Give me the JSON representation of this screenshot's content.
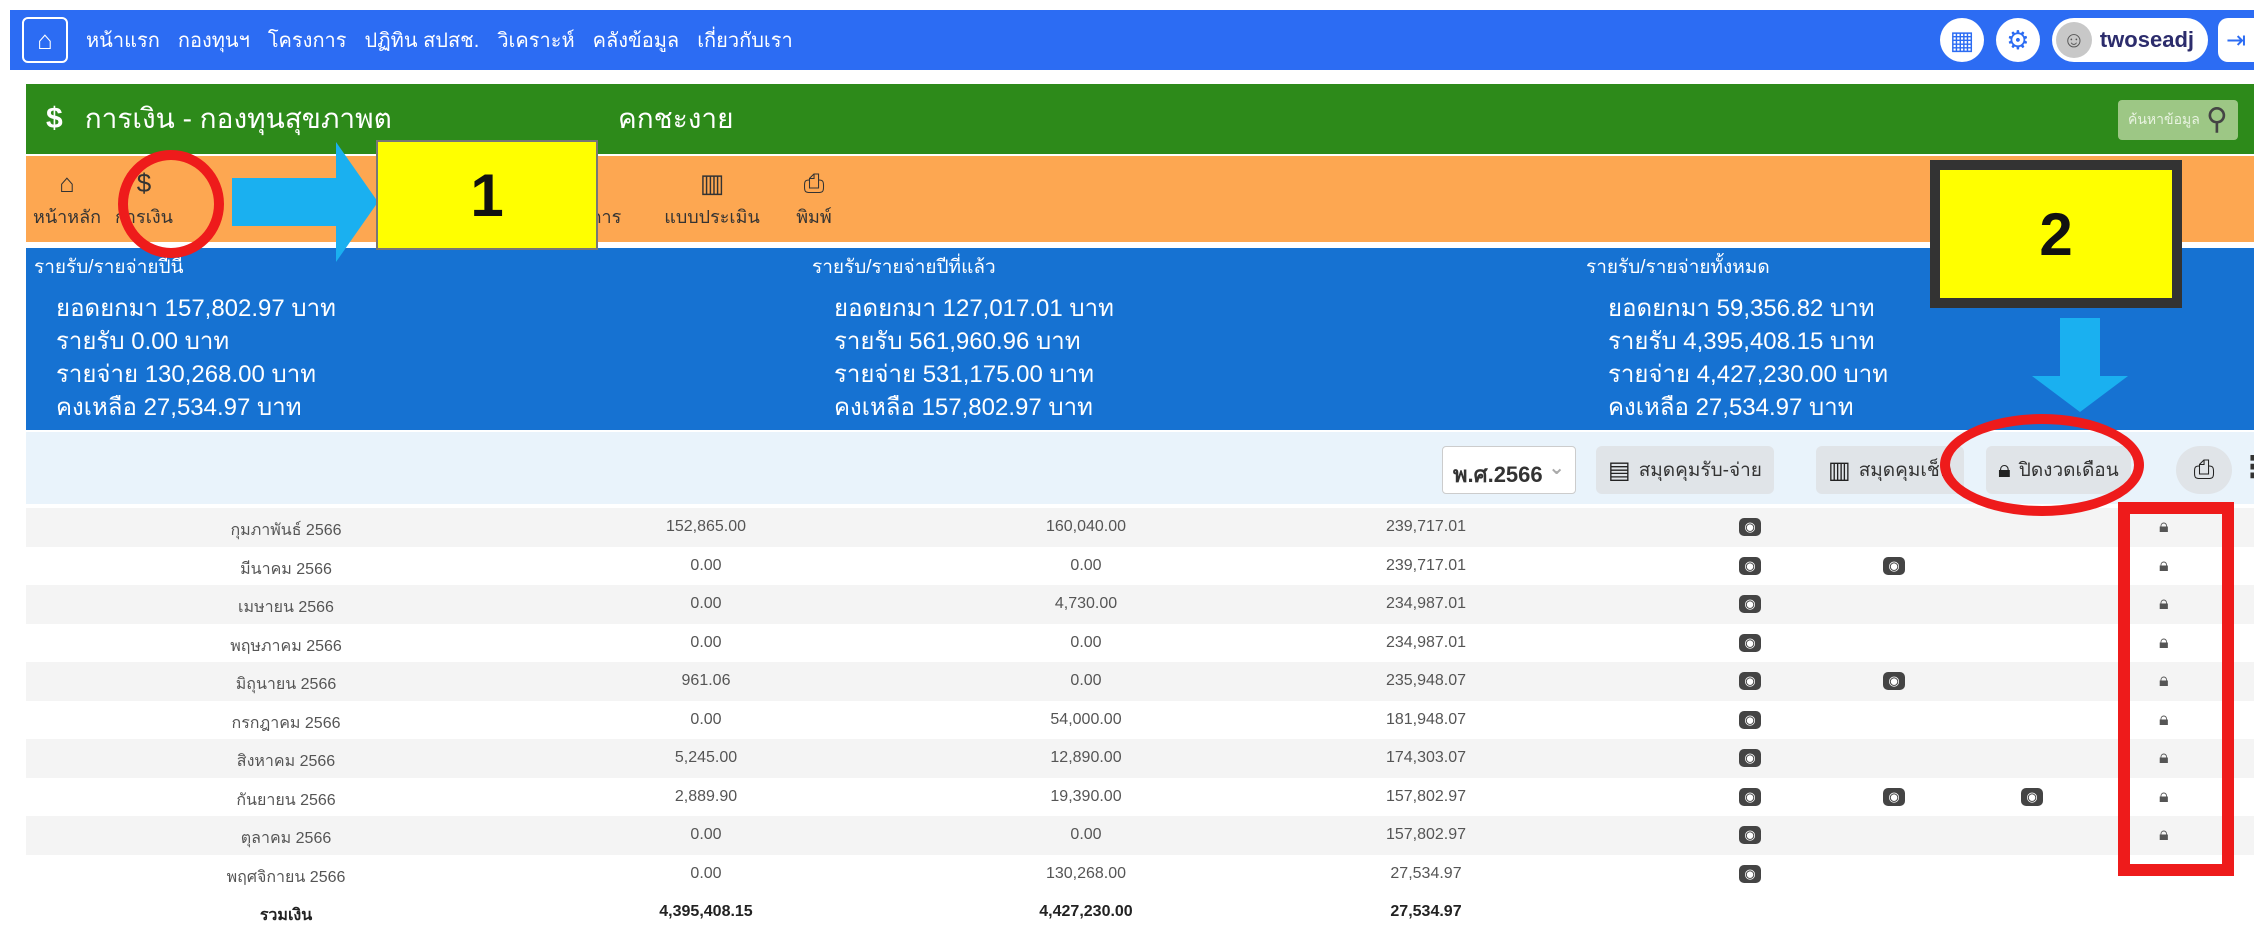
{
  "nav": {
    "menu": [
      "หน้าแรก",
      "กองทุนฯ",
      "โครงการ",
      "ปฏิทิน สปสช.",
      "วิเคราะห์",
      "คลังข้อมูล",
      "เกี่ยวกับเรา"
    ],
    "user": "twoseadj"
  },
  "title_bar": {
    "icon": "$",
    "text": "การเงิน - กองทุนสุขภาพต",
    "text_tail": "คกชะงาย",
    "search_placeholder": "ค้นหาข้อมูล"
  },
  "toolbar": {
    "home": "หน้าหลัก",
    "finance": "การเงิน",
    "tab3_tail": "การ",
    "evaluation": "แบบประเมิน",
    "print": "พิมพ์"
  },
  "summary": {
    "col1": {
      "head": "รายรับ/รายจ่ายปีนี้",
      "lines": [
        "ยอดยกมา 157,802.97 บาท",
        "รายรับ 0.00 บาท",
        "รายจ่าย 130,268.00 บาท",
        "คงเหลือ 27,534.97 บาท"
      ]
    },
    "col2": {
      "head": "รายรับ/รายจ่ายปีที่แล้ว",
      "lines": [
        "ยอดยกมา 127,017.01 บาท",
        "รายรับ 561,960.96 บาท",
        "รายจ่าย 531,175.00 บาท",
        "คงเหลือ 157,802.97 บาท"
      ]
    },
    "col3": {
      "head": "รายรับ/รายจ่ายทั้งหมด",
      "lines": [
        "ยอดยกมา 59,356.82 บาท",
        "รายรับ 4,395,408.15 บาท",
        "รายจ่าย 4,427,230.00 บาท",
        "คงเหลือ 27,534.97 บาท"
      ]
    }
  },
  "filters": {
    "year": "พ.ศ.2566",
    "cashbook": "สมุดคุมรับ-จ่าย",
    "chequebook": "สมุดคุมเช็ค",
    "close_period": "ปิดงวดเดือน"
  },
  "table": {
    "rows": [
      [
        "กุมภาพันธ์ 2566",
        "152,865.00",
        "160,040.00",
        "239,717.01"
      ],
      [
        "มีนาคม 2566",
        "0.00",
        "0.00",
        "239,717.01"
      ],
      [
        "เมษายน 2566",
        "0.00",
        "4,730.00",
        "234,987.01"
      ],
      [
        "พฤษภาคม 2566",
        "0.00",
        "0.00",
        "234,987.01"
      ],
      [
        "มิถุนายน 2566",
        "961.06",
        "0.00",
        "235,948.07"
      ],
      [
        "กรกฎาคม 2566",
        "0.00",
        "54,000.00",
        "181,948.07"
      ],
      [
        "สิงหาคม 2566",
        "5,245.00",
        "12,890.00",
        "174,303.07"
      ],
      [
        "กันยายน 2566",
        "2,889.90",
        "19,390.00",
        "157,802.97"
      ],
      [
        "ตุลาคม 2566",
        "0.00",
        "0.00",
        "157,802.97"
      ],
      [
        "พฤศจิกายน 2566",
        "0.00",
        "130,268.00",
        "27,534.97"
      ]
    ],
    "total": [
      "รวมเงิน",
      "4,395,408.15",
      "4,427,230.00",
      "27,534.97"
    ]
  },
  "annotations": {
    "step1": "1",
    "step2": "2"
  }
}
